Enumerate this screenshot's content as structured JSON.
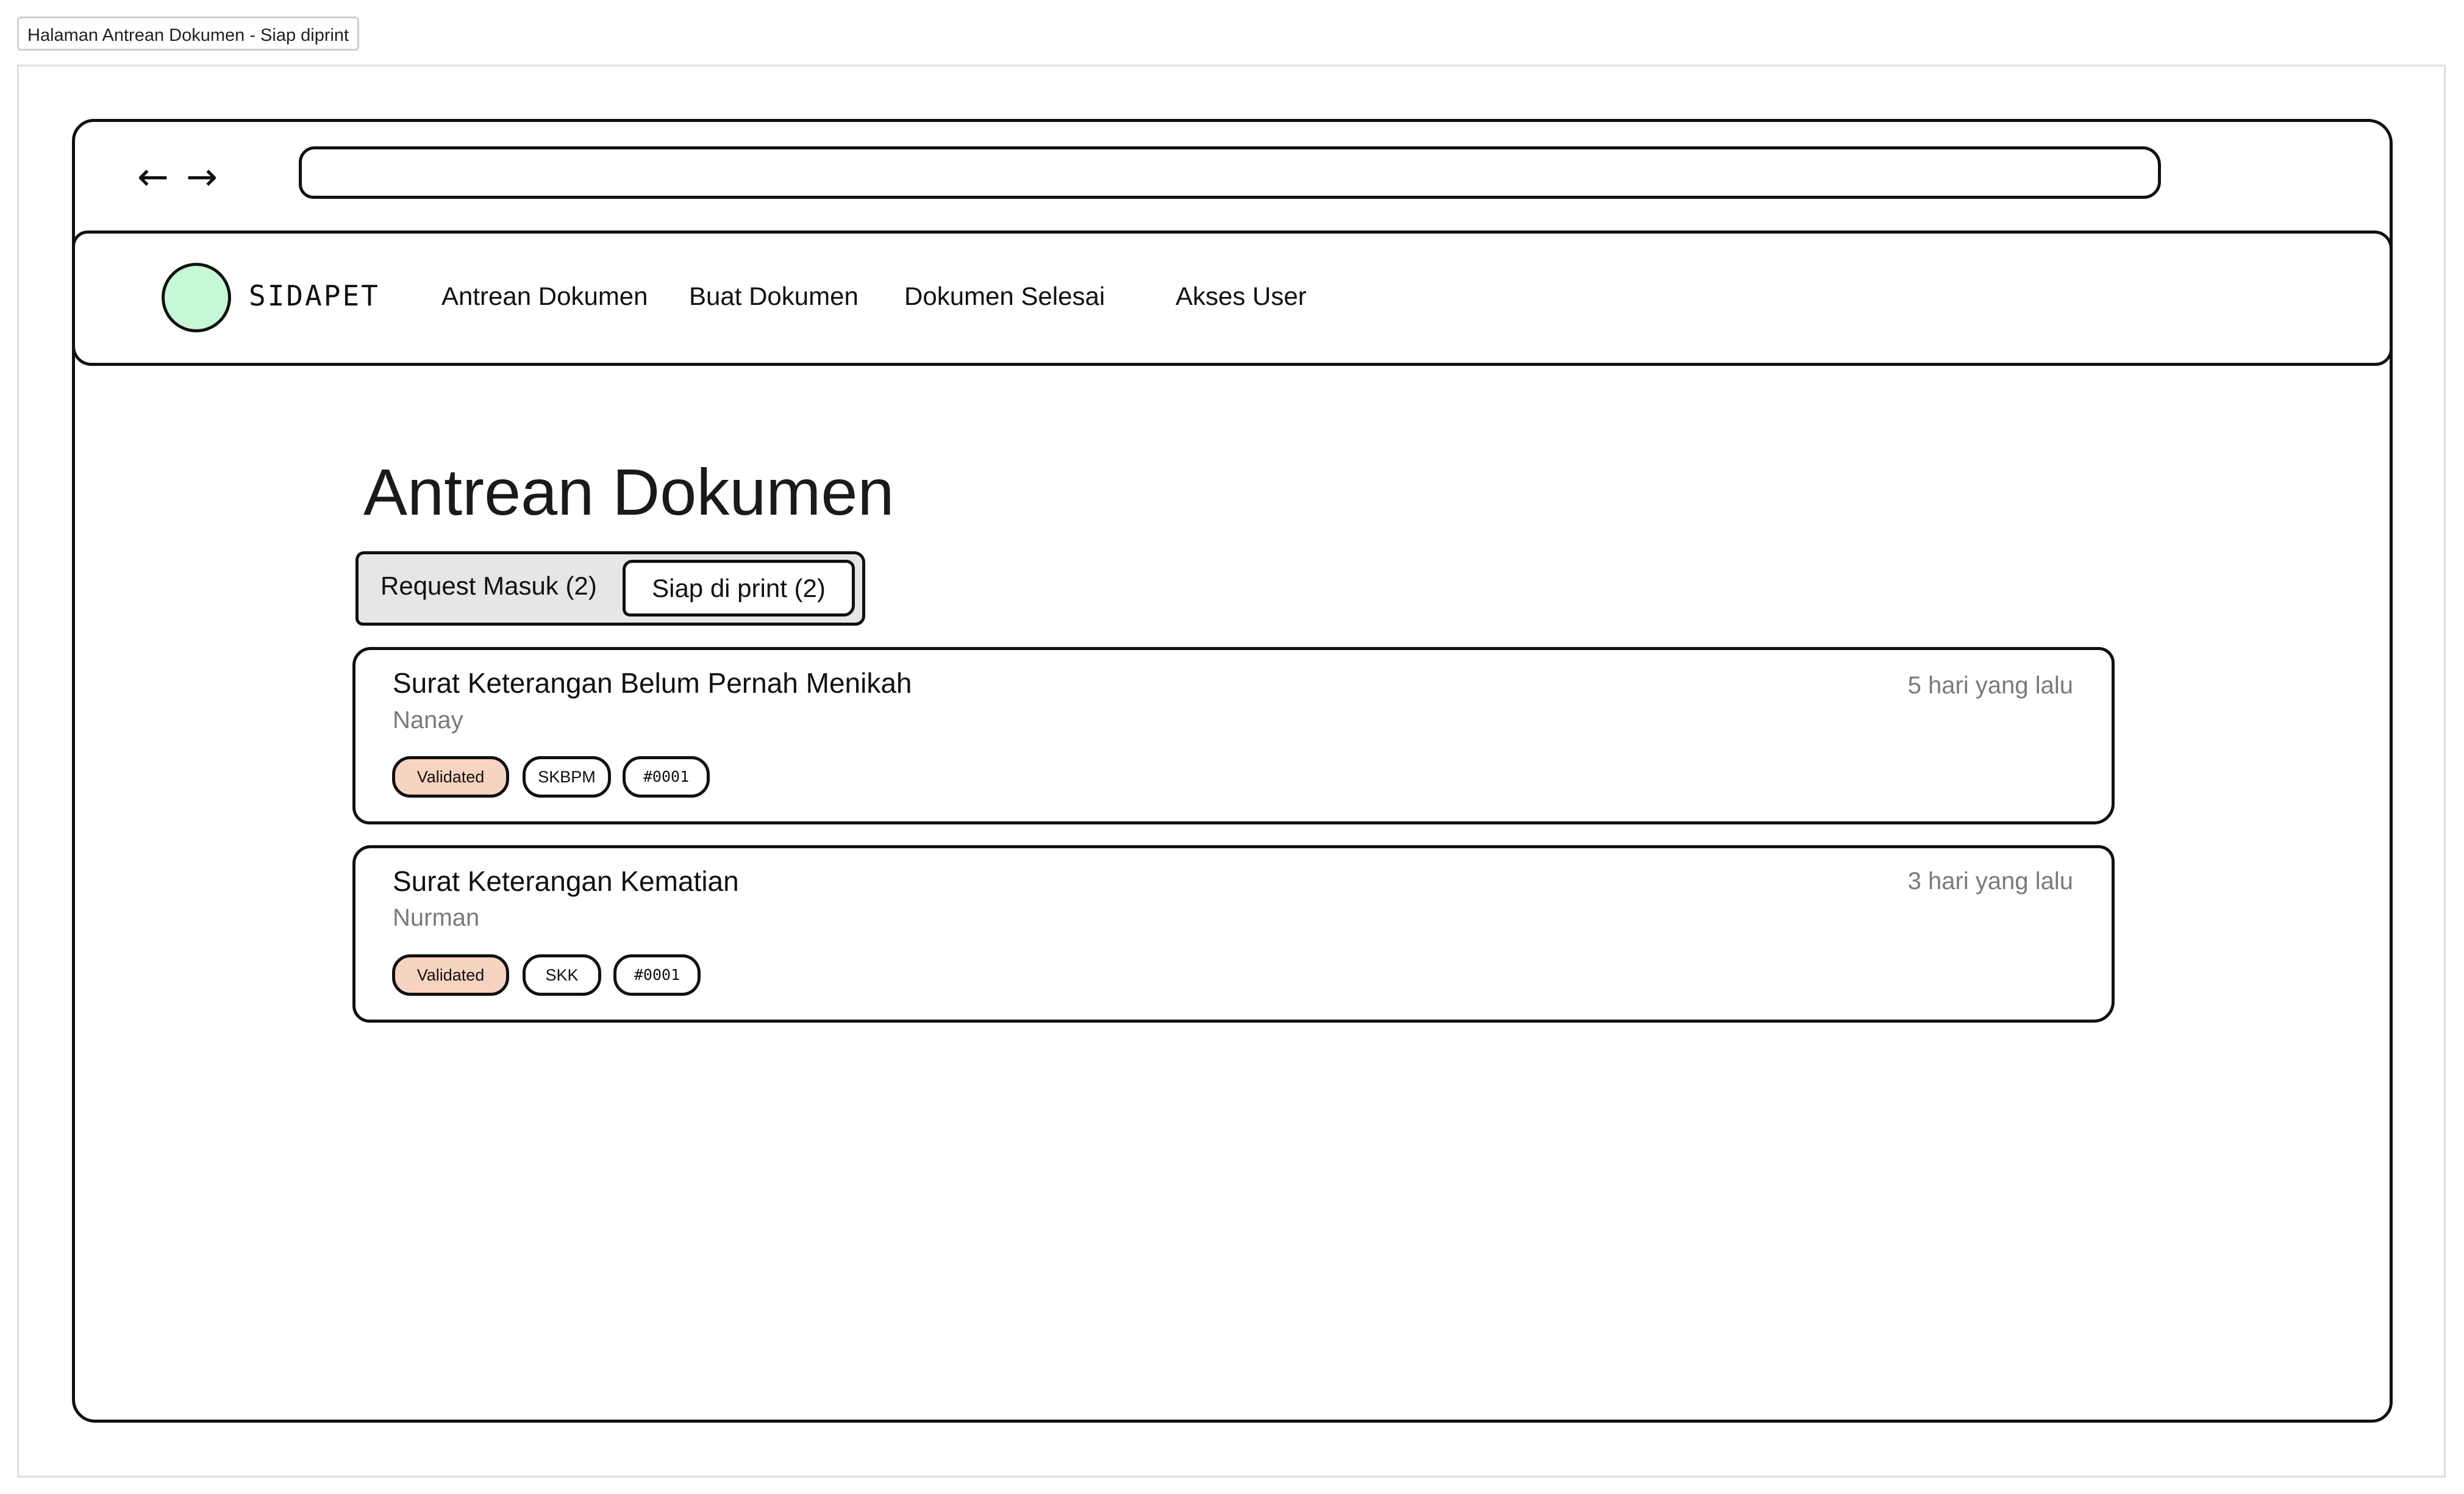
{
  "frame_label": "Halaman Antrean Dokumen - Siap diprint",
  "browser": {
    "back_glyph": "←",
    "forward_glyph": "→",
    "url": ""
  },
  "header": {
    "brand": "SIDAPET",
    "logo_color": "#c6f7d6",
    "menu": [
      {
        "label": "Antrean Dokumen"
      },
      {
        "label": "Buat Dokumen"
      },
      {
        "label": "Dokumen Selesai"
      },
      {
        "label": "Akses User"
      }
    ]
  },
  "main": {
    "title": "Antrean Dokumen",
    "tabs": [
      {
        "label": "Request Masuk (2)",
        "active": false
      },
      {
        "label": "Siap di print (2)",
        "active": true
      }
    ],
    "documents": [
      {
        "title": "Surat Keterangan Belum Pernah Menikah",
        "name": "Nanay",
        "time": "5 hari yang lalu",
        "status": "Validated",
        "code": "SKBPM",
        "number": "#0001"
      },
      {
        "title": "Surat Keterangan Kematian",
        "name": "Nurman",
        "time": "3 hari yang lalu",
        "status": "Validated",
        "code": "SKK",
        "number": "#0001"
      }
    ]
  },
  "colors": {
    "status_badge": "#f7d3c1",
    "tab_group_bg": "#e6e6e6",
    "muted_text": "#7a7a7a"
  }
}
